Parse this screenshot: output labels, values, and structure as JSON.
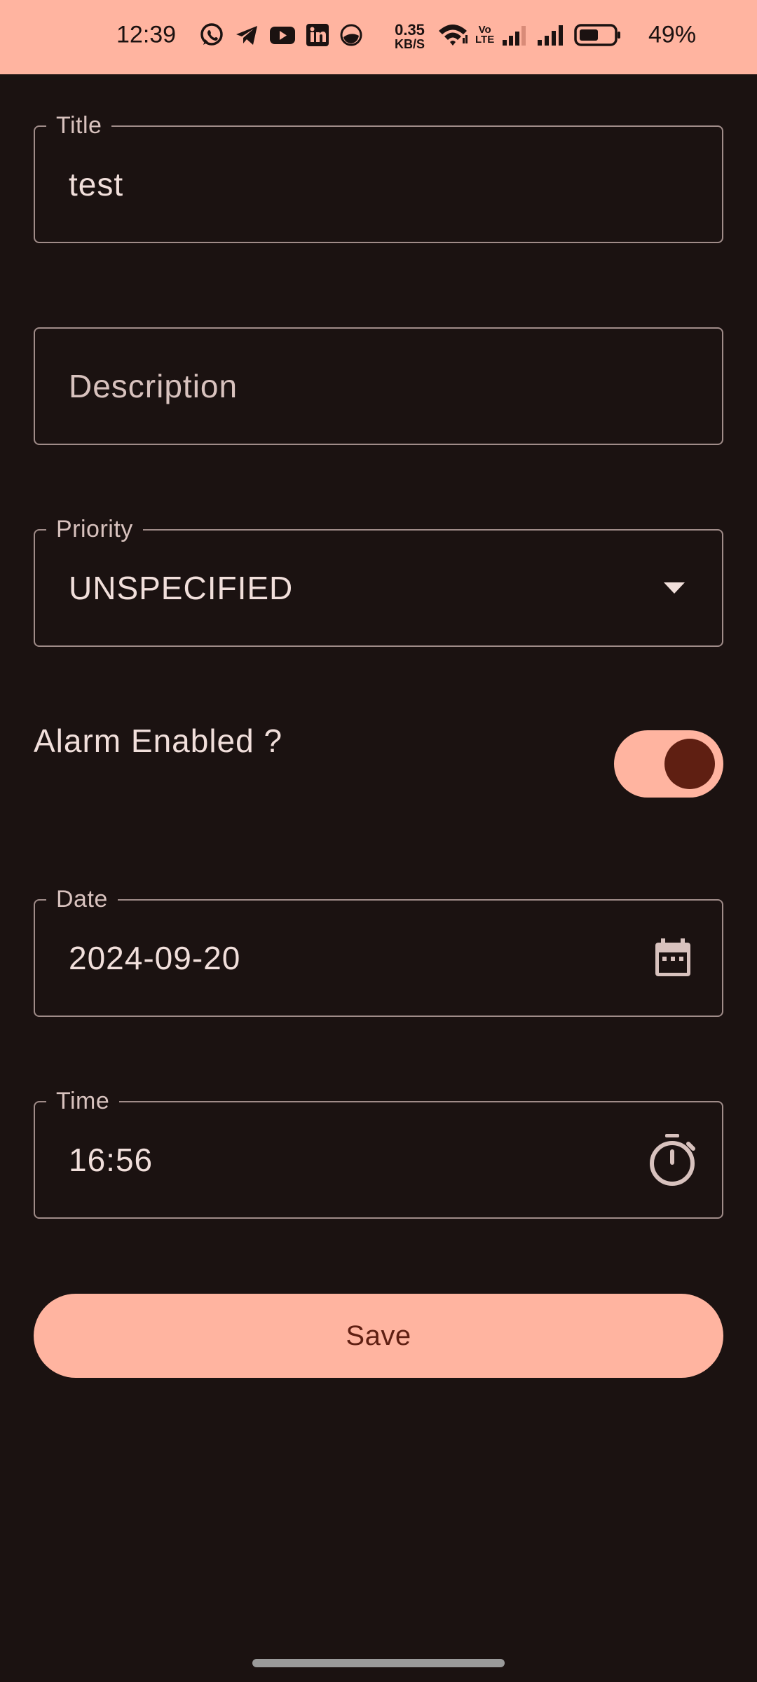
{
  "status_bar": {
    "time": "12:39",
    "app_icons": [
      "whatsapp-icon",
      "telegram-icon",
      "youtube-icon",
      "linkedin-icon",
      "moon-app-icon"
    ],
    "net_speed_value": "0.35",
    "net_speed_unit": "KB/S",
    "volte_line1": "Vo",
    "volte_line2": "LTE",
    "battery_percent": "49%"
  },
  "form": {
    "title": {
      "label": "Title",
      "value": "test"
    },
    "description": {
      "placeholder": "Description"
    },
    "priority": {
      "label": "Priority",
      "value": "UNSPECIFIED",
      "icon": "dropdown-arrow-icon"
    },
    "alarm": {
      "label": "Alarm Enabled ?",
      "enabled": true
    },
    "date": {
      "label": "Date",
      "value": "2024-09-20",
      "icon": "calendar-icon"
    },
    "time": {
      "label": "Time",
      "value": "16:56",
      "icon": "timer-icon"
    },
    "save_label": "Save"
  },
  "colors": {
    "background": "#1b1211",
    "accent": "#ffb4a0",
    "accent_dark": "#5f1f12",
    "outline": "#a08c89",
    "text": "#f1dfdb",
    "label": "#d8c2be"
  }
}
